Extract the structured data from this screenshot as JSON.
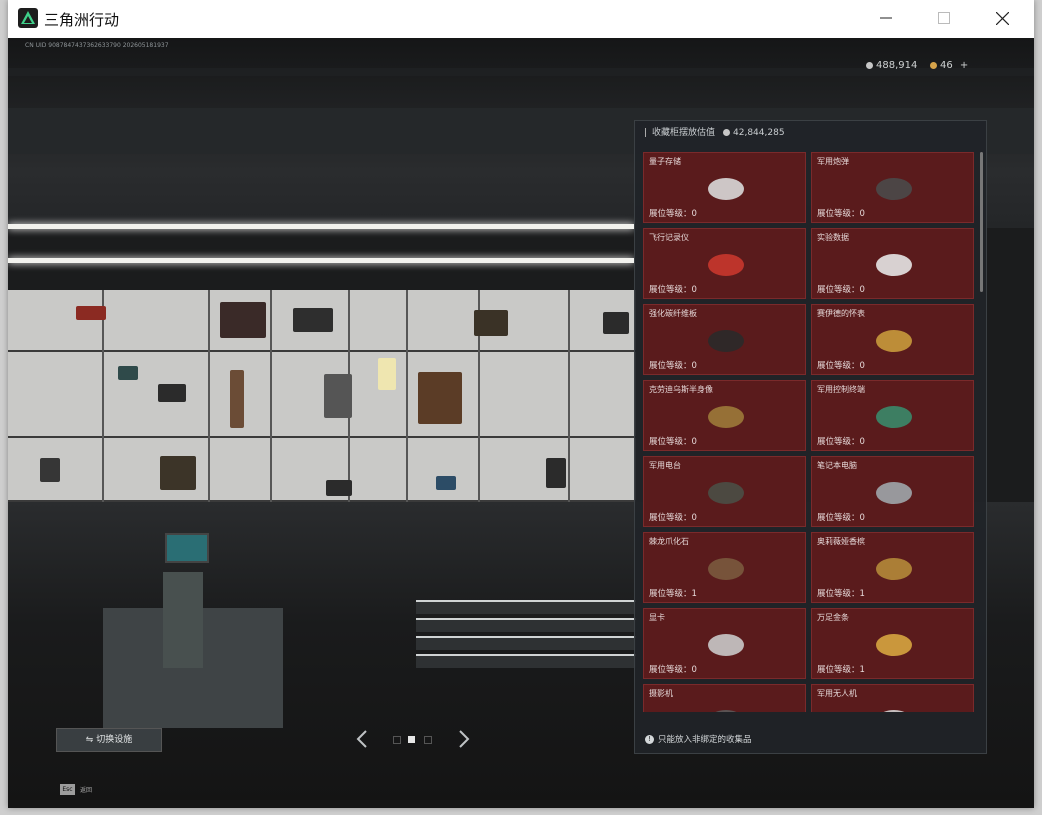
{
  "window": {
    "title": "三角洲行动",
    "controls": [
      "minimize-icon",
      "maximize-icon",
      "close-icon"
    ]
  },
  "hud": {
    "uid_line": "CN UID 9087847437362633790 202605181937",
    "currency_silver": "488,914",
    "currency_gold": "46",
    "currency_add": "+"
  },
  "panel": {
    "title": "收藏柜摆放估值",
    "total_value": "42,844,285",
    "footer_note": "只能放入非绑定的收集品",
    "items": [
      {
        "name": "量子存储",
        "level": "展位等级：0",
        "icon": "usb-drive-icon"
      },
      {
        "name": "军用炮弹",
        "level": "展位等级：0",
        "icon": "shell-icon"
      },
      {
        "name": "飞行记录仪",
        "level": "展位等级：0",
        "icon": "flight-recorder-icon"
      },
      {
        "name": "实验数据",
        "level": "展位等级：0",
        "icon": "disc-icon"
      },
      {
        "name": "强化碳纤维板",
        "level": "展位等级：0",
        "icon": "carbon-plate-icon"
      },
      {
        "name": "赛伊德的怀表",
        "level": "展位等级：0",
        "icon": "pocket-watch-icon"
      },
      {
        "name": "克劳迪乌斯半身像",
        "level": "展位等级：0",
        "icon": "bust-icon"
      },
      {
        "name": "军用控制终端",
        "level": "展位等级：0",
        "icon": "control-terminal-icon"
      },
      {
        "name": "军用电台",
        "level": "展位等级：0",
        "icon": "radio-icon"
      },
      {
        "name": "笔记本电脑",
        "level": "展位等级：0",
        "icon": "laptop-icon"
      },
      {
        "name": "棘龙爪化石",
        "level": "展位等级：1",
        "icon": "fossil-claw-icon"
      },
      {
        "name": "奥莉薇娅香槟",
        "level": "展位等级：1",
        "icon": "champagne-icon"
      },
      {
        "name": "显卡",
        "level": "展位等级：0",
        "icon": "graphics-card-icon"
      },
      {
        "name": "万足金条",
        "level": "展位等级：1",
        "icon": "gold-bar-icon"
      },
      {
        "name": "摄影机",
        "level": "",
        "icon": "camera-icon"
      },
      {
        "name": "军用无人机",
        "level": "",
        "icon": "drone-icon"
      }
    ]
  },
  "bottom": {
    "switch_facility": "切换设施",
    "esc_key": "Esc",
    "esc_label": "返回"
  },
  "colors": {
    "card_bg": "#5a1b1c",
    "panel_bg": "#202428"
  }
}
